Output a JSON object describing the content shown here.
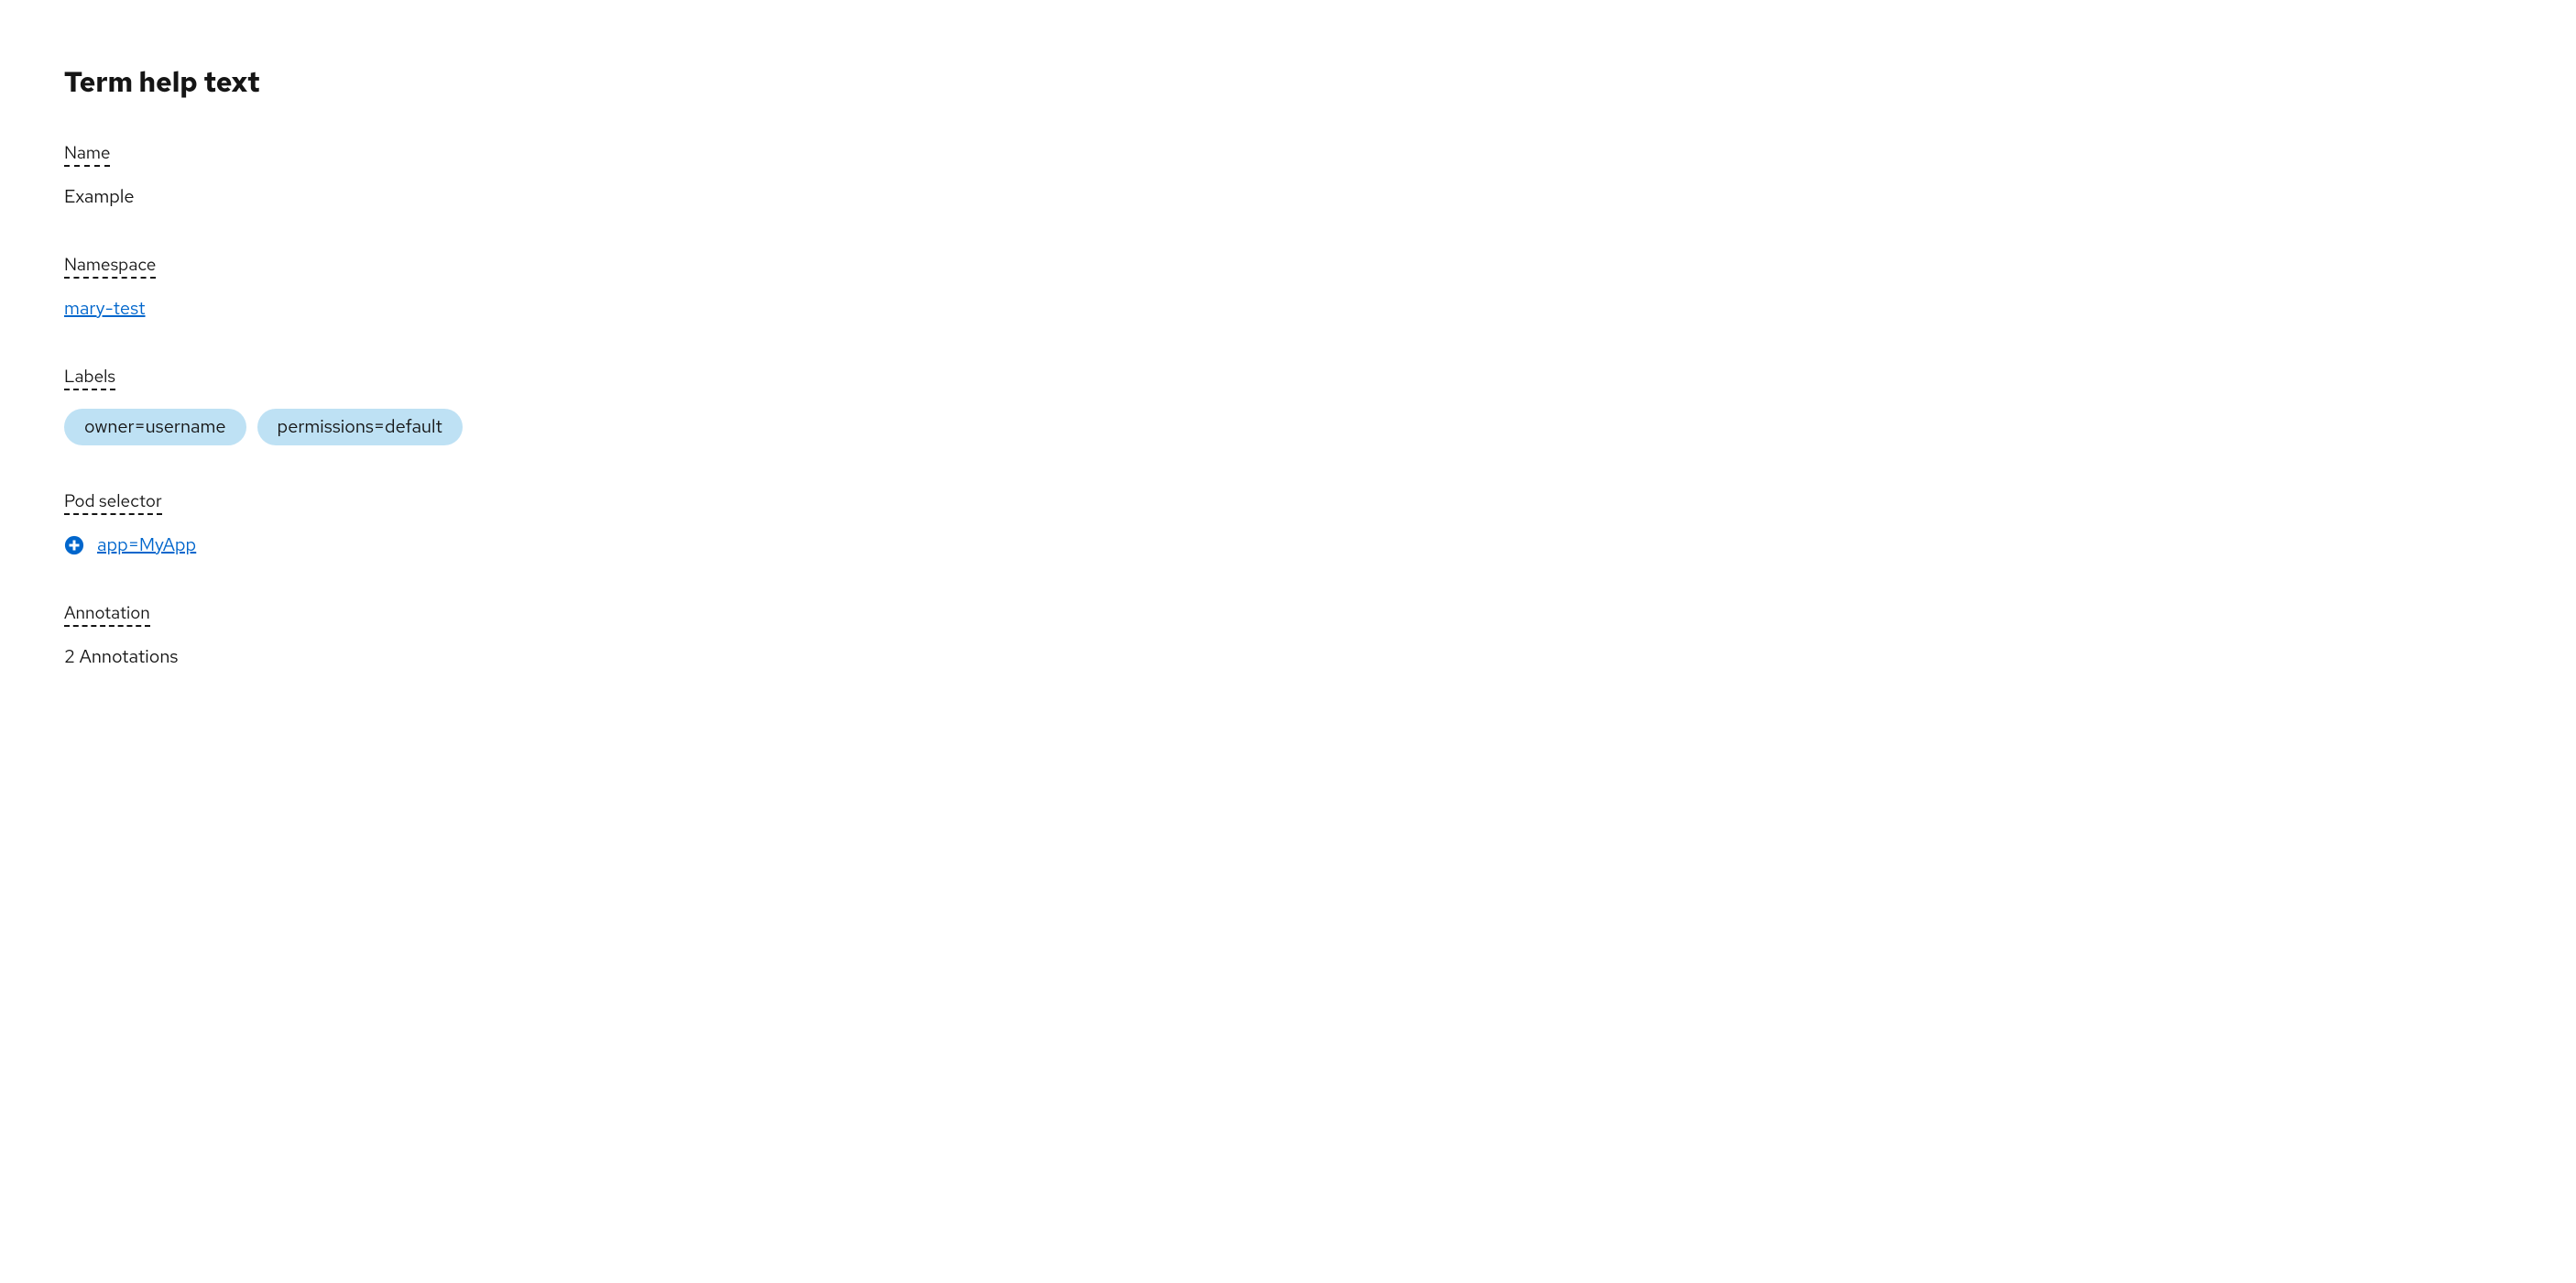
{
  "title": "Term help text",
  "groups": {
    "name": {
      "label": "Name",
      "value": "Example"
    },
    "namespace": {
      "label": "Namespace",
      "value": "mary-test"
    },
    "labels": {
      "label": "Labels",
      "items": [
        "owner=username",
        "permissions=default"
      ]
    },
    "pod_selector": {
      "label": "Pod selector",
      "value": "app=MyApp"
    },
    "annotation": {
      "label": "Annotation",
      "value": "2 Annotations"
    }
  },
  "colors": {
    "link": "#0066cc",
    "chip_bg": "#bee1f4",
    "text": "#151515"
  }
}
